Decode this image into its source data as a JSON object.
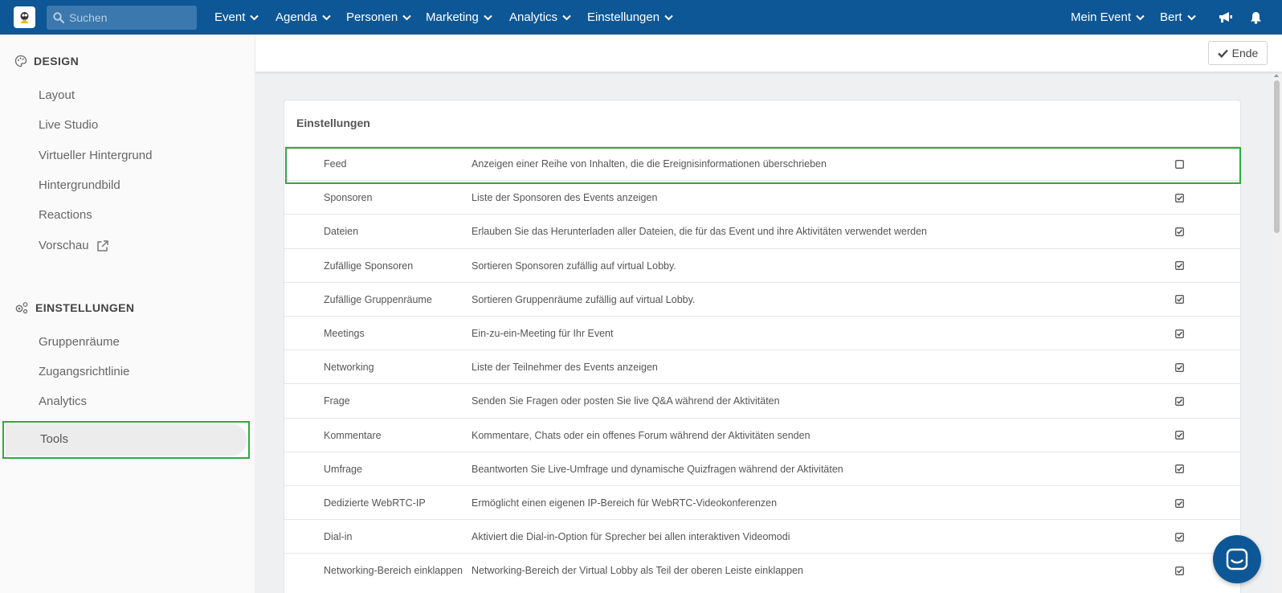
{
  "topbar": {
    "search_placeholder": "Suchen",
    "menus": [
      "Event",
      "Agenda",
      "Personen",
      "Marketing",
      "Analytics",
      "Einstellungen"
    ],
    "right_menus": [
      "Mein Event",
      "Bert"
    ]
  },
  "sidebar": {
    "design_title": "DESIGN",
    "design_items": [
      "Layout",
      "Live Studio",
      "Virtueller Hintergrund",
      "Hintergrundbild",
      "Reactions",
      "Vorschau"
    ],
    "settings_title": "EINSTELLUNGEN",
    "settings_items": [
      "Gruppenräume",
      "Zugangsrichtlinie",
      "Analytics",
      "Tools"
    ],
    "active_item": "Tools"
  },
  "toolbar": {
    "end_label": "Ende"
  },
  "card": {
    "title": "Einstellungen",
    "rows": [
      {
        "name": "Feed",
        "desc": "Anzeigen einer Reihe von Inhalten, die die Ereignisinformationen überschrieben",
        "checked": false
      },
      {
        "name": "Sponsoren",
        "desc": "Liste der Sponsoren des Events anzeigen",
        "checked": true
      },
      {
        "name": "Dateien",
        "desc": "Erlauben Sie das Herunterladen aller Dateien, die für das Event und ihre Aktivitäten verwendet werden",
        "checked": true
      },
      {
        "name": "Zufällige Sponsoren",
        "desc": "Sortieren Sponsoren zufällig auf virtual Lobby.",
        "checked": true
      },
      {
        "name": "Zufällige Gruppenräume",
        "desc": "Sortieren Gruppenräume zufällig auf virtual Lobby.",
        "checked": true
      },
      {
        "name": "Meetings",
        "desc": "Ein-zu-ein-Meeting für Ihr Event",
        "checked": true
      },
      {
        "name": "Networking",
        "desc": "Liste der Teilnehmer des Events anzeigen",
        "checked": true
      },
      {
        "name": "Frage",
        "desc": "Senden Sie Fragen oder posten Sie live Q&A während der Aktivitäten",
        "checked": true
      },
      {
        "name": "Kommentare",
        "desc": "Kommentare, Chats oder ein offenes Forum während der Aktivitäten senden",
        "checked": true
      },
      {
        "name": "Umfrage",
        "desc": "Beantworten Sie Live-Umfrage und dynamische Quizfragen während der Aktivitäten",
        "checked": true
      },
      {
        "name": "Dedizierte WebRTC-IP",
        "desc": "Ermöglicht einen eigenen IP-Bereich für WebRTC-Videokonferenzen",
        "checked": true
      },
      {
        "name": "Dial-in",
        "desc": "Aktiviert die Dial-in-Option für Sprecher bei allen interaktiven Videomodi",
        "checked": true
      },
      {
        "name": "Networking-Bereich einklappen",
        "desc": "Networking-Bereich der Virtual Lobby als Teil der oberen Leiste einklappen",
        "checked": true
      }
    ]
  },
  "colors": {
    "nav_bg": "#0e5796",
    "highlight": "#2eab3f"
  },
  "icons": [
    "search-icon",
    "chevron-down-icon",
    "megaphone-icon",
    "bell-icon",
    "palette-icon",
    "gears-icon",
    "external-link-icon",
    "check-icon",
    "checkbox-icon",
    "chat-icon"
  ]
}
